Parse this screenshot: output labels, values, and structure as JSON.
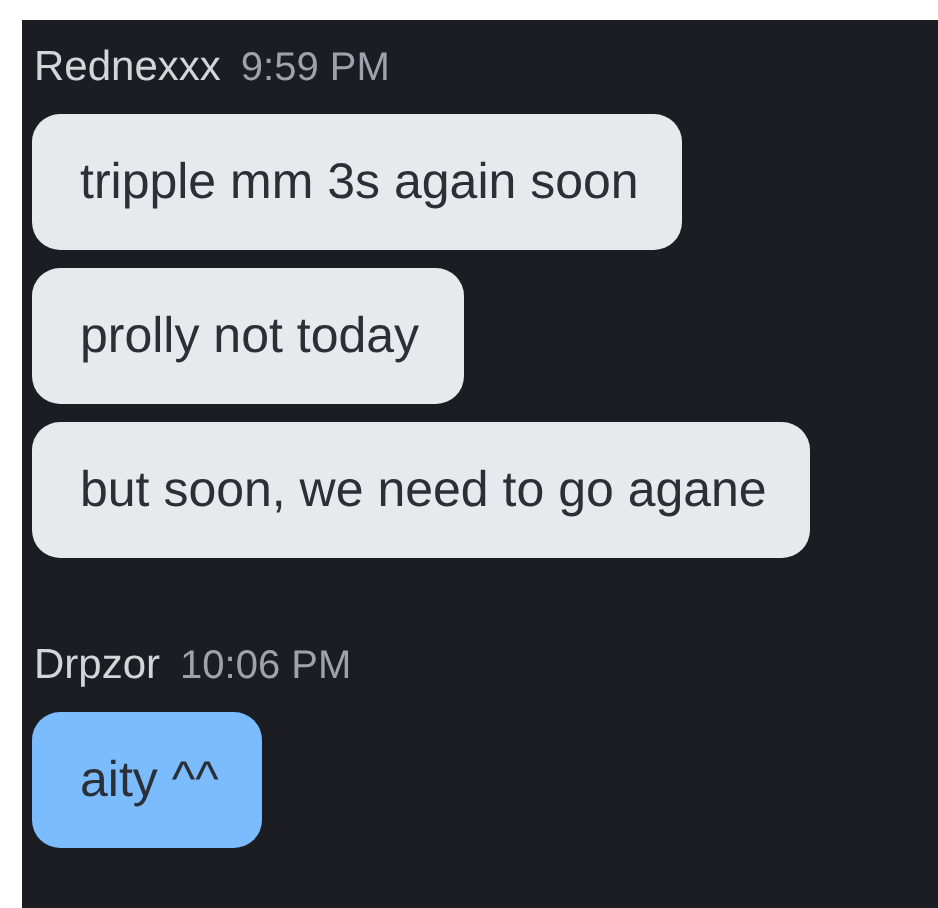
{
  "groups": [
    {
      "author": "Rednexxx",
      "time": "9:59 PM",
      "color": "#e8e9ed",
      "messages": [
        "tripple mm 3s again soon",
        "prolly not today",
        "but soon, we need to go agane"
      ]
    },
    {
      "author": "Drpzor",
      "time": "10:06 PM",
      "color": "#7abcfd",
      "messages": [
        "aity ^^"
      ]
    }
  ]
}
